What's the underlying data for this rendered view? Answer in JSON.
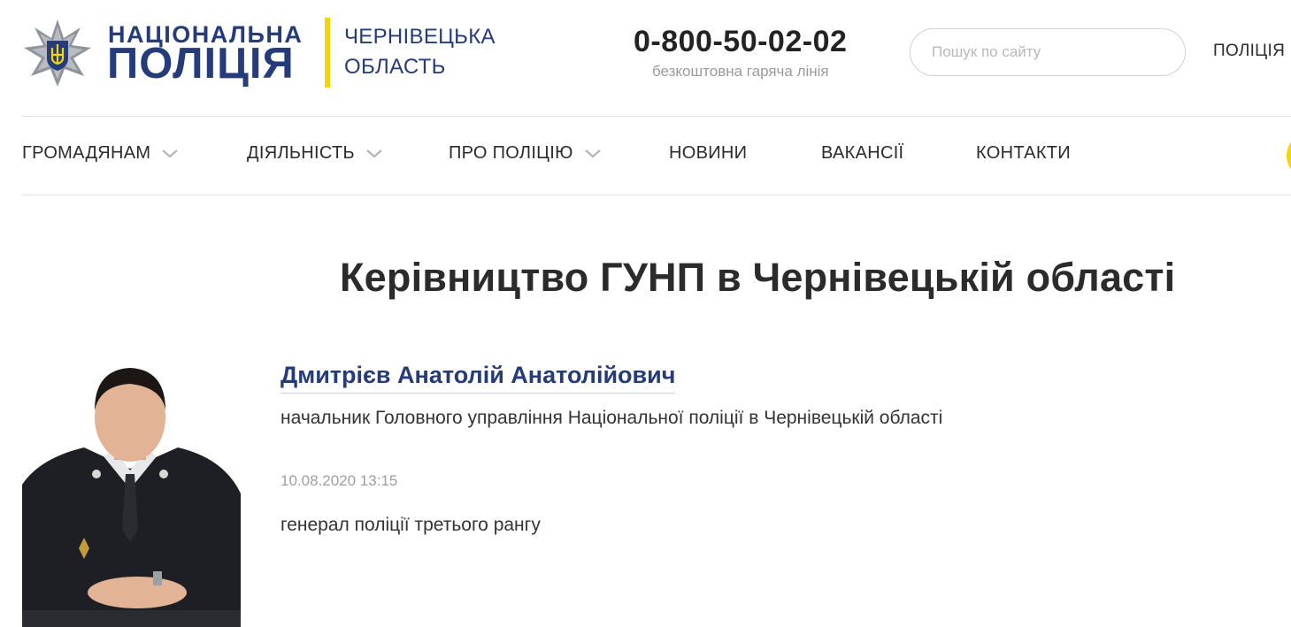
{
  "header": {
    "logo_line1": "НАЦІОНАЛЬНА",
    "logo_line2": "ПОЛІЦІЯ",
    "region_line1": "ЧЕРНІВЕЦЬКА",
    "region_line2": "ОБЛАСТЬ",
    "hotline_number": "0-800-50-02-02",
    "hotline_caption": "безкоштовна гаряча лінія",
    "search_placeholder": "Пошук по сайту",
    "police_link": "ПОЛІЦІЯ",
    "brand_color": "#253b7a",
    "accent_color": "#f4d40b"
  },
  "nav": {
    "items": [
      {
        "label": "ГРОМАДЯНАМ",
        "has_dropdown": true
      },
      {
        "label": "ДІЯЛЬНІСТЬ",
        "has_dropdown": true
      },
      {
        "label": "ПРО ПОЛІЦІЮ",
        "has_dropdown": true
      },
      {
        "label": "НОВИНИ",
        "has_dropdown": false
      },
      {
        "label": "ВАКАНСІЇ",
        "has_dropdown": false
      },
      {
        "label": "КОНТАКТИ",
        "has_dropdown": false
      }
    ]
  },
  "main": {
    "title": "Керівництво ГУНП в Чернівецькій області",
    "person": {
      "name": "Дмитрієв Анатолій Анатолійович",
      "position": "начальник Головного управління Національної поліції в Чернівецькій області",
      "date": "10.08.2020 13:15",
      "rank": "генерал поліції третього рангу"
    }
  }
}
